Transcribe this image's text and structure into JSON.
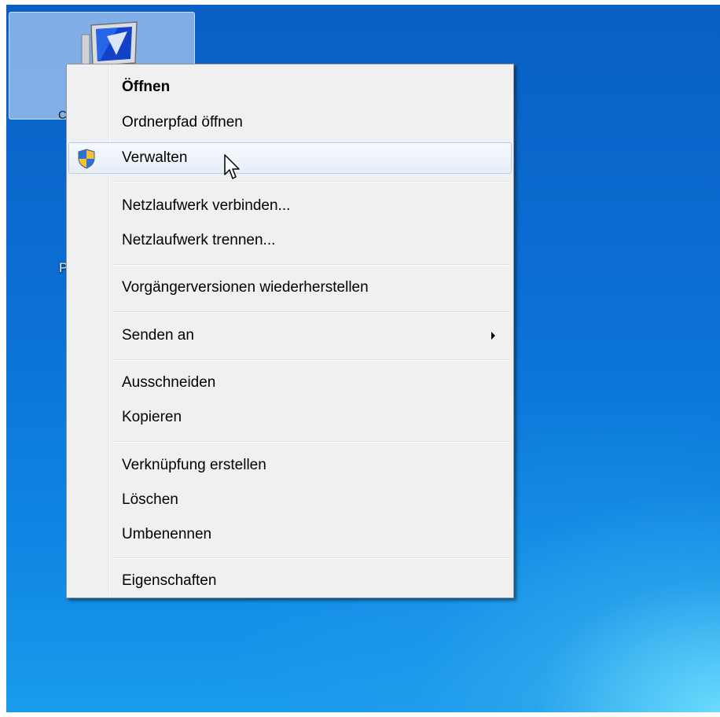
{
  "desktop": {
    "icon_label_fragment": "C",
    "side_label_fragment": "P"
  },
  "context_menu": {
    "items": [
      {
        "label": "Öffnen",
        "bold": true
      },
      {
        "label": "Ordnerpfad öffnen"
      },
      {
        "label": "Verwalten",
        "icon": "uac-shield-icon",
        "highlighted": true
      },
      {
        "label": "Netzlaufwerk verbinden..."
      },
      {
        "label": "Netzlaufwerk trennen..."
      },
      {
        "label": "Vorgängerversionen wiederherstellen"
      },
      {
        "label": "Senden an",
        "submenu": true
      },
      {
        "label": "Ausschneiden"
      },
      {
        "label": "Kopieren"
      },
      {
        "label": "Verknüpfung erstellen"
      },
      {
        "label": "Löschen"
      },
      {
        "label": "Umbenennen"
      },
      {
        "label": "Eigenschaften"
      }
    ]
  },
  "colors": {
    "menu_background": "#f0f0f0",
    "menu_border": "#979797",
    "highlight_border": "#aecff7",
    "desktop_blue": "#0b6ed3"
  }
}
